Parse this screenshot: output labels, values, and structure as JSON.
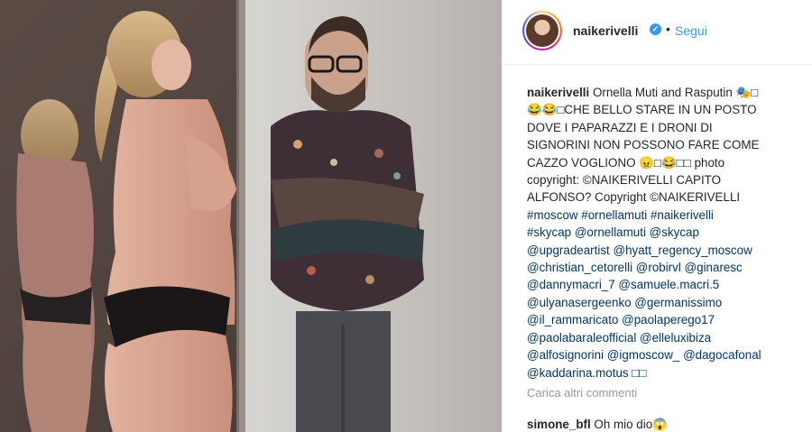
{
  "post": {
    "username": "naikerivelli",
    "verified_icon": "✓",
    "separator": "•",
    "follow_label": "Segui",
    "caption_lines": [
      "Ornella Muti and Rasputin 🎭□",
      "😂😂□CHE BELLO STARE IN UN POSTO",
      "DOVE I PAPARAZZI E I DRONI DI",
      "SIGNORINI NON POSSONO FARE COME",
      "CAZZO VOGLIONO 😠□😂□□ photo",
      "copyright: ©NAIKERIVELLI CAPITO",
      "ALFONSO? Copyright ©NAIKERIVELLI",
      "#moscow #ornellamuti #naikerivelli",
      "#skycap @ornellamuti @skycap",
      "@upgradeartist @hyatt_regency_moscow",
      "@christian_cetorelli @robirvl @ginaresc",
      "@dannymacri_7 @samuele.macri.5",
      "@ulyanasergeenko @germanissimo",
      "@il_rammaricato @paolaperego17",
      "@paolabaraleofficial @elleluxibiza",
      "@alfosignorini @igmoscow_ @dagocafonal",
      "@kaddarina.motus □□"
    ],
    "load_more_label": "Carica altri commenti",
    "comment": {
      "username": "simone_bfl",
      "text": "Oh mio dio😱"
    }
  }
}
